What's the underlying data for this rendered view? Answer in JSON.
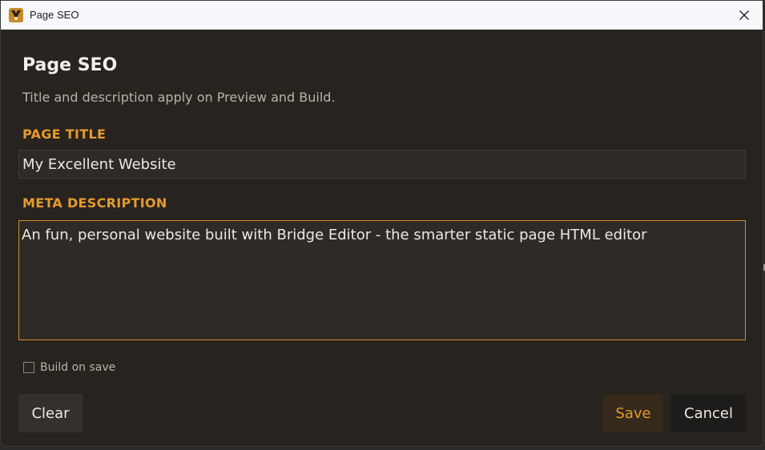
{
  "window": {
    "title": "Page SEO",
    "app_icon": "bridge-editor-logo-icon",
    "close_icon": "close-icon"
  },
  "dialog": {
    "heading": "Page SEO",
    "subtitle": "Title and description apply on Preview and Build.",
    "page_title": {
      "label": "PAGE TITLE",
      "value": "My Excellent Website"
    },
    "meta_description": {
      "label": "META DESCRIPTION",
      "value": "An fun, personal website built with Bridge Editor - the smarter static page HTML editor"
    },
    "build_on_save": {
      "label": "Build on save",
      "checked": false
    },
    "buttons": {
      "clear": "Clear",
      "save": "Save",
      "cancel": "Cancel"
    }
  },
  "colors": {
    "accent": "#e59a2f",
    "background": "#27231f",
    "text": "#ece8e1",
    "muted": "#b9b2a6"
  }
}
